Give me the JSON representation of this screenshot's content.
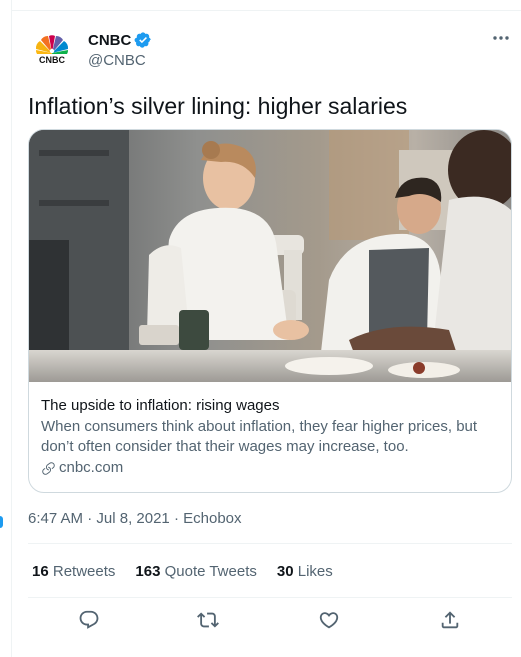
{
  "tweet": {
    "author": {
      "display_name": "CNBC",
      "handle": "@CNBC",
      "verified": true,
      "avatar_icon": "cnbc-peacock-logo"
    },
    "text": "Inflation’s silver lining: higher salaries",
    "card": {
      "image_alt": "chefs-in-kitchen-photo",
      "title": "The upside to inflation: rising wages",
      "description_line1": "When consumers think about inflation, they fear higher prices, but",
      "description_line2": "don’t often consider that their wages may increase, too.",
      "domain": "cnbc.com"
    },
    "meta": {
      "time": "6:47 AM",
      "separator1": " · ",
      "date": "Jul 8, 2021",
      "separator2": " · ",
      "source": "Echobox"
    },
    "stats": {
      "retweets_count": "16",
      "retweets_label": "Retweets",
      "quotes_count": "163",
      "quotes_label": "Quote Tweets",
      "likes_count": "30",
      "likes_label": "Likes"
    },
    "actions": {
      "reply_icon": "reply-icon",
      "retweet_icon": "retweet-icon",
      "like_icon": "heart-icon",
      "share_icon": "share-icon"
    }
  },
  "colors": {
    "accent": "#1d9bf0",
    "text_primary": "#0f1419",
    "text_secondary": "#536471",
    "border": "#cfd9de"
  }
}
